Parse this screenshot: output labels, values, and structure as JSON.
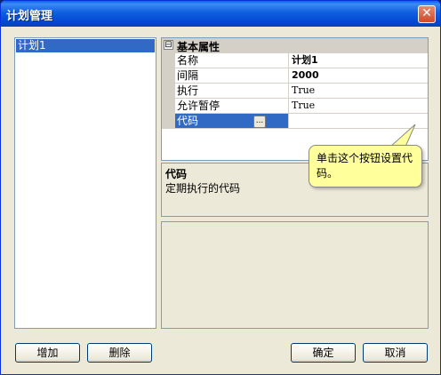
{
  "window": {
    "title": "计划管理",
    "close_label": "✕"
  },
  "list": {
    "items": [
      "计划1"
    ]
  },
  "property_grid": {
    "category": {
      "expander": "⊟",
      "label": "基本属性"
    },
    "rows": [
      {
        "name": "名称",
        "value": "计划1"
      },
      {
        "name": "间隔",
        "value": "2000"
      },
      {
        "name": "执行",
        "value": "True"
      },
      {
        "name": "允许暂停",
        "value": "True"
      },
      {
        "name": "代码",
        "value": ""
      }
    ],
    "ellipsis_label": "..."
  },
  "description": {
    "title": "代码",
    "text": "定期执行的代码"
  },
  "tooltip": {
    "text": "单击这个按钮设置代码。"
  },
  "buttons": {
    "add": "增加",
    "delete": "删除",
    "ok": "确定",
    "cancel": "取消"
  },
  "colors": {
    "selection": "#316ac5",
    "tooltip_bg": "#ffff9c",
    "dialog_bg": "#ece9d8"
  }
}
